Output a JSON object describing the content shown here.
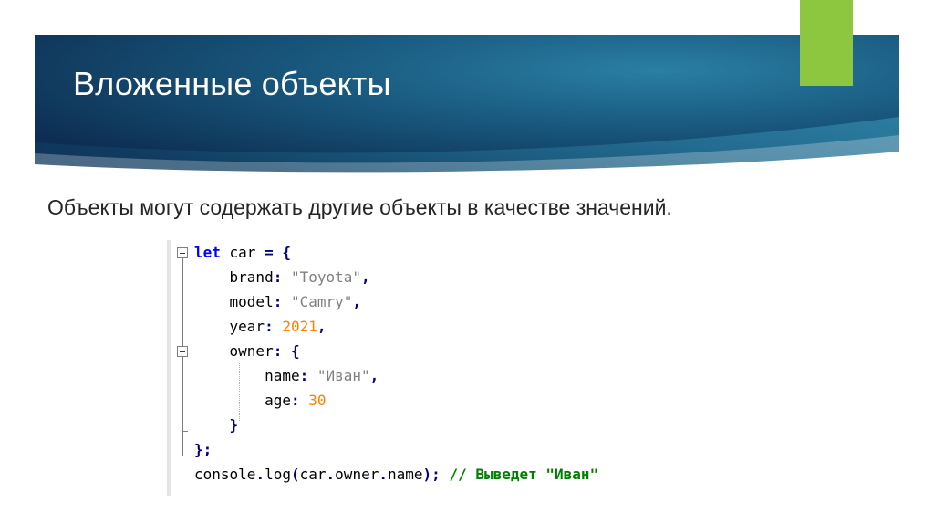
{
  "slide": {
    "title": "Вложенные объекты",
    "subtitle": "Объекты могут содержать другие объекты в качестве значений."
  },
  "colors": {
    "banner_dark": "#0f3256",
    "banner_light": "#1e6e92",
    "accent_green": "#8dc63f",
    "keyword": "#0000ff",
    "string": "#808080",
    "number": "#ff8000",
    "comment": "#008000"
  },
  "code": {
    "lines": [
      [
        {
          "t": "let",
          "c": "kw"
        },
        {
          "t": " car ",
          "c": "plain"
        },
        {
          "t": "=",
          "c": "op"
        },
        {
          "t": " ",
          "c": "plain"
        },
        {
          "t": "{",
          "c": "op"
        }
      ],
      [
        {
          "t": "    brand",
          "c": "plain"
        },
        {
          "t": ":",
          "c": "op"
        },
        {
          "t": " ",
          "c": "plain"
        },
        {
          "t": "\"Toyota\"",
          "c": "str"
        },
        {
          "t": ",",
          "c": "op"
        }
      ],
      [
        {
          "t": "    model",
          "c": "plain"
        },
        {
          "t": ":",
          "c": "op"
        },
        {
          "t": " ",
          "c": "plain"
        },
        {
          "t": "\"Camry\"",
          "c": "str"
        },
        {
          "t": ",",
          "c": "op"
        }
      ],
      [
        {
          "t": "    year",
          "c": "plain"
        },
        {
          "t": ":",
          "c": "op"
        },
        {
          "t": " ",
          "c": "plain"
        },
        {
          "t": "2021",
          "c": "num"
        },
        {
          "t": ",",
          "c": "op"
        }
      ],
      [
        {
          "t": "    owner",
          "c": "plain"
        },
        {
          "t": ":",
          "c": "op"
        },
        {
          "t": " ",
          "c": "plain"
        },
        {
          "t": "{",
          "c": "op"
        }
      ],
      [
        {
          "t": "        name",
          "c": "plain"
        },
        {
          "t": ":",
          "c": "op"
        },
        {
          "t": " ",
          "c": "plain"
        },
        {
          "t": "\"Иван\"",
          "c": "str"
        },
        {
          "t": ",",
          "c": "op"
        }
      ],
      [
        {
          "t": "        age",
          "c": "plain"
        },
        {
          "t": ":",
          "c": "op"
        },
        {
          "t": " ",
          "c": "plain"
        },
        {
          "t": "30",
          "c": "num"
        }
      ],
      [
        {
          "t": "    ",
          "c": "plain"
        },
        {
          "t": "}",
          "c": "op"
        }
      ],
      [
        {
          "t": "}",
          "c": "op"
        },
        {
          "t": ";",
          "c": "op"
        }
      ],
      [
        {
          "t": "console",
          "c": "plain"
        },
        {
          "t": ".",
          "c": "op"
        },
        {
          "t": "log",
          "c": "plain"
        },
        {
          "t": "(",
          "c": "op"
        },
        {
          "t": "car",
          "c": "plain"
        },
        {
          "t": ".",
          "c": "op"
        },
        {
          "t": "owner",
          "c": "plain"
        },
        {
          "t": ".",
          "c": "op"
        },
        {
          "t": "name",
          "c": "plain"
        },
        {
          "t": ")",
          "c": "op"
        },
        {
          "t": ";",
          "c": "op"
        },
        {
          "t": " ",
          "c": "plain"
        },
        {
          "t": "// Выведет \"Иван\"",
          "c": "cm"
        }
      ]
    ]
  }
}
